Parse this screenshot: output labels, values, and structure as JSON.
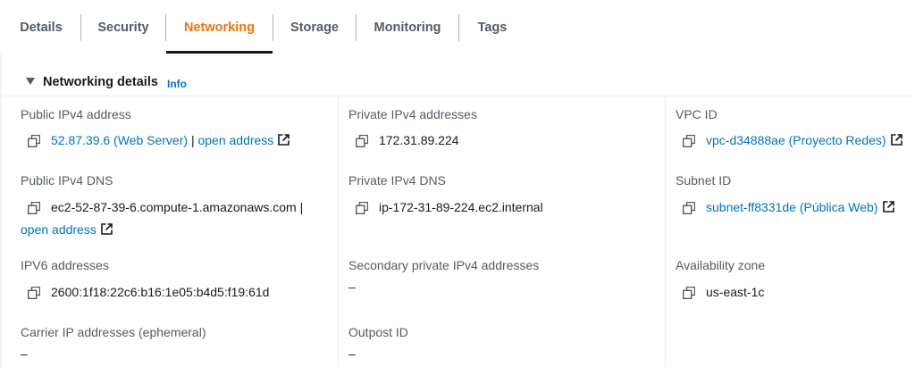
{
  "tabs": [
    {
      "label": "Details"
    },
    {
      "label": "Security"
    },
    {
      "label": "Networking"
    },
    {
      "label": "Storage"
    },
    {
      "label": "Monitoring"
    },
    {
      "label": "Tags"
    }
  ],
  "active_tab": "Networking",
  "section": {
    "title": "Networking details",
    "info": "Info"
  },
  "fields": {
    "public_ipv4_address": {
      "label": "Public IPv4 address",
      "value": "52.87.39.6 (Web Server)",
      "separator": "|",
      "action": "open address"
    },
    "public_ipv4_dns": {
      "label": "Public IPv4 DNS",
      "value": "ec2-52-87-39-6.compute-1.amazonaws.com",
      "separator": "|",
      "action": "open address"
    },
    "ipv6_addresses": {
      "label": "IPV6 addresses",
      "value": "2600:1f18:22c6:b16:1e05:b4d5:f19:61d"
    },
    "carrier_ip": {
      "label": "Carrier IP addresses (ephemeral)",
      "value": "–"
    },
    "private_ipv4_addresses": {
      "label": "Private IPv4 addresses",
      "value": "172.31.89.224"
    },
    "private_ipv4_dns": {
      "label": "Private IPv4 DNS",
      "value": "ip-172-31-89-224.ec2.internal"
    },
    "secondary_private_ipv4": {
      "label": "Secondary private IPv4 addresses",
      "value": "–"
    },
    "outpost_id": {
      "label": "Outpost ID",
      "value": "–"
    },
    "vpc_id": {
      "label": "VPC ID",
      "value": "vpc-d34888ae (Proyecto Redes)"
    },
    "subnet_id": {
      "label": "Subnet ID",
      "value": "subnet-ff8331de (Pública Web)"
    },
    "availability_zone": {
      "label": "Availability zone",
      "value": "us-east-1c"
    }
  },
  "colors": {
    "accent": "#ec7211",
    "link": "#0073bb",
    "label": "#545b64",
    "text": "#16191f"
  },
  "icons": [
    "copy-icon",
    "external-link-icon",
    "caret-down-icon"
  ]
}
